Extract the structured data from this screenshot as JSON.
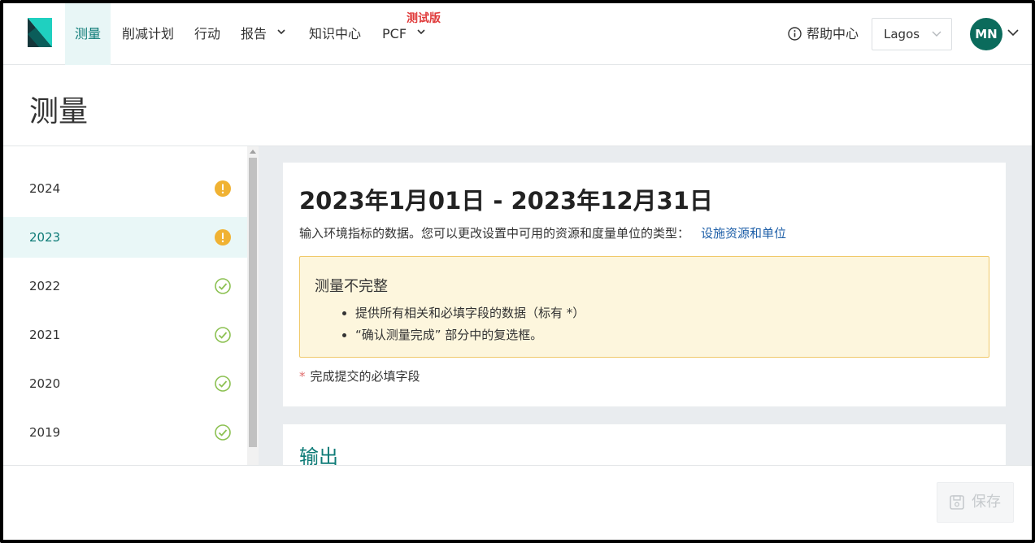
{
  "nav": {
    "items": [
      {
        "label": "测量"
      },
      {
        "label": "削减计划"
      },
      {
        "label": "行动"
      },
      {
        "label": "报告"
      },
      {
        "label": "知识中心"
      },
      {
        "label": "PCF"
      }
    ],
    "beta_label": "测试版",
    "help_label": "帮助中心",
    "site_selector_value": "Lagos",
    "avatar_initials": "MN"
  },
  "page": {
    "title": "测量"
  },
  "sidebar": {
    "years": [
      {
        "label": "2024",
        "status": "warning-icon"
      },
      {
        "label": "2023",
        "status": "warning-icon"
      },
      {
        "label": "2022",
        "status": "check-icon"
      },
      {
        "label": "2021",
        "status": "check-icon"
      },
      {
        "label": "2020",
        "status": "check-icon"
      },
      {
        "label": "2019",
        "status": "check-icon"
      }
    ]
  },
  "main": {
    "period_title": "2023年1月01日 - 2023年12月31日",
    "description": "输入环境指标的数据。您可以更改设置中可用的资源和度量单位的类型：",
    "settings_link": "设施资源和单位",
    "alert": {
      "title": "测量不完整",
      "items": [
        "提供所有相关和必填字段的数据（标有 *）",
        "“确认测量完成” 部分中的复选框。"
      ]
    },
    "required_note_star": "*",
    "required_note": "完成提交的必填字段",
    "section_title": "输出"
  },
  "footer": {
    "save_label": "保存"
  },
  "colors": {
    "brand": "#0e7b77",
    "warning": "#f0b233",
    "success": "#8cc152",
    "avatar": "#0b6b5c",
    "beta": "#e03b3b"
  }
}
